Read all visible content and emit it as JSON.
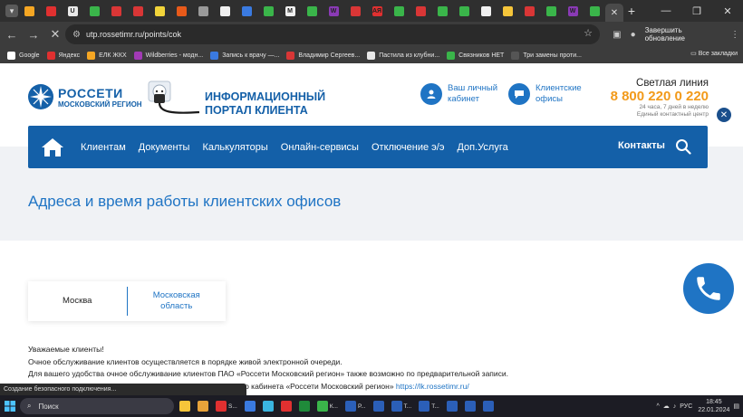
{
  "browser": {
    "url": "utp.rossetimr.ru/points/cok",
    "update_label": "Завершить обновление",
    "tab_favicon_colors": [
      "#f5a623",
      "#e03030",
      "#e8e8e8",
      "#3ab54a",
      "#d93636",
      "#d93636",
      "#f2d43a",
      "#e85a1a",
      "#9a9a9a",
      "#f0f0f0",
      "#3a7ae0",
      "#3ab54a",
      "#f0f0f0",
      "#3ab54a",
      "#8a3ab5",
      "#d93636",
      "#e03030",
      "#3ab54a",
      "#d93636",
      "#3ab54a",
      "#3ab54a",
      "#f0f0f0",
      "#f5c53a",
      "#d93636",
      "#3ab54a",
      "#8a3ab5",
      "#3ab54a"
    ],
    "tab_favicon_labels": [
      "",
      "",
      "U",
      "",
      "",
      "",
      "",
      "",
      "",
      "",
      "",
      "",
      "M",
      "",
      "W",
      "",
      "АЯ",
      "",
      "",
      "",
      "",
      "",
      "",
      "",
      "",
      "W",
      ""
    ],
    "bookmarks": [
      {
        "label": "Google",
        "color": "#ffffff"
      },
      {
        "label": "Яндекс",
        "color": "#e03030"
      },
      {
        "label": "ЕЛК ЖКХ",
        "color": "#f5a623"
      },
      {
        "label": "Wildberries - модн...",
        "color": "#a23ab5"
      },
      {
        "label": "Запись к врачу —...",
        "color": "#3a7ae0"
      },
      {
        "label": "Владимир Сергеев...",
        "color": "#d93636"
      },
      {
        "label": "Пастила из клубни...",
        "color": "#e8e8e8"
      },
      {
        "label": "Связников НЕТ",
        "color": "#3ab54a"
      },
      {
        "label": "Три замены проти...",
        "color": "#555555"
      }
    ],
    "bookmarks_all": "Все закладки"
  },
  "header": {
    "logo_line1": "РОССЕТИ",
    "logo_line2": "МОСКОВСКИЙ РЕГИОН",
    "portal_line1": "ИНФОРМАЦИОННЫЙ",
    "portal_line2": "ПОРТАЛ КЛИЕНТА",
    "cabinet_line1": "Ваш личный",
    "cabinet_line2": "кабинет",
    "offices_line1": "Клиентские",
    "offices_line2": "офисы",
    "hotline_title": "Светлая линия",
    "hotline_phone": "8 800 220 0 220",
    "hotline_sub1": "24 часа, 7 дней в неделю",
    "hotline_sub2": "Единый контактный центр"
  },
  "nav": {
    "items": [
      "Клиентам",
      "Документы",
      "Калькуляторы",
      "Онлайн-сервисы",
      "Отключение э/э",
      "Доп.Услуга"
    ],
    "contacts": "Контакты"
  },
  "main": {
    "title": "Адреса и время работы клиентских офисов",
    "tab_moscow": "Москва",
    "tab_region_line1": "Московская",
    "tab_region_line2": "область",
    "notice_line1": "Уважаемые клиенты!",
    "notice_line2": "Очное обслуживание клиентов осуществляется в порядке живой электронной очереди.",
    "notice_line3": "Для вашего удобства очное обслуживание клиентов ПАО «Россети Московский регион» также возможно по предварительной записи.",
    "notice_line4_text": "Личного кабинета «Россети Московский регион»",
    "notice_line4_link": "https://lk.rossetimr.ru/"
  },
  "status_popup": "Создание безопасного подключения...",
  "taskbar": {
    "search_placeholder": "Поиск",
    "apps": [
      {
        "label": "",
        "color": "#f5c53a"
      },
      {
        "label": "",
        "color": "#e8a33a"
      },
      {
        "label": "S...",
        "color": "#e03030"
      },
      {
        "label": "",
        "color": "#3a7ae0"
      },
      {
        "label": "",
        "color": "#3ab5e0"
      },
      {
        "label": "",
        "color": "#e03030"
      },
      {
        "label": "",
        "color": "#1f8a3a"
      },
      {
        "label": "К...",
        "color": "#3ab54a"
      },
      {
        "label": "Р...",
        "color": "#2b5fb8"
      },
      {
        "label": "",
        "color": "#2b5fb8"
      },
      {
        "label": "Т...",
        "color": "#2b5fb8"
      },
      {
        "label": "Т...",
        "color": "#2b5fb8"
      },
      {
        "label": "",
        "color": "#2b5fb8"
      },
      {
        "label": "",
        "color": "#2b5fb8"
      },
      {
        "label": "",
        "color": "#2b5fb8"
      }
    ],
    "lang": "РУС",
    "time": "18:45",
    "date": "22.01.2024"
  },
  "colors": {
    "brand_blue": "#1460a8",
    "link_blue": "#1f74c4",
    "hotline_orange": "#f29a1a"
  }
}
